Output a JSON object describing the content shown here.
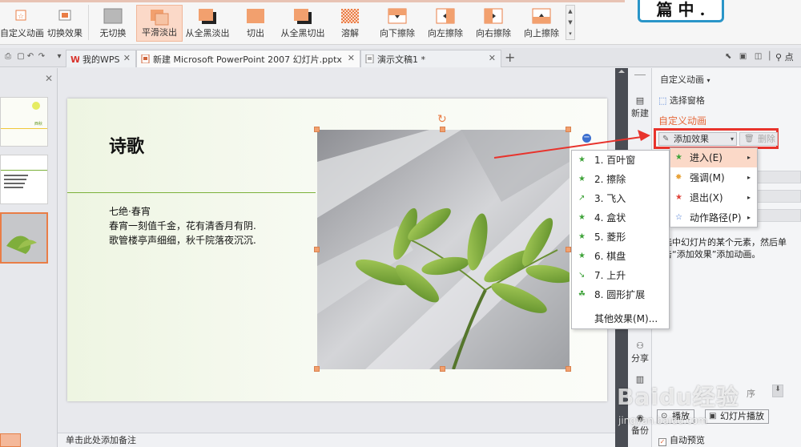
{
  "ribbon": {
    "custom_anim": "自定义动画",
    "switch_effect": "切换效果",
    "transitions": [
      "无切换",
      "平滑淡出",
      "从全黑淡出",
      "切出",
      "从全黑切出",
      "溶解",
      "向下擦除",
      "向左擦除",
      "向右擦除",
      "向上擦除"
    ],
    "active_transition": "平滑淡出"
  },
  "badge": {
    "text": "篇 中 ."
  },
  "tabbar": {
    "wps_tab": "我的WPS",
    "doc_tab": "新建 Microsoft PowerPoint 2007 幻灯片.pptx",
    "demo_tab": "演示文稿1 *",
    "search": "点"
  },
  "slide": {
    "title": "诗歌",
    "poem_title": "七绝·春宵",
    "poem_line1": "春宵一刻值千金，花有清香月有阴.",
    "poem_line2": "歌管楼亭声细细，秋千院落夜沉沉."
  },
  "notes": {
    "placeholder": "单击此处添加备注"
  },
  "vstrip": {
    "new": "新建",
    "share": "分享",
    "backup": "备份"
  },
  "panel": {
    "header": "自定义动画",
    "select_pane": "选择窗格",
    "title": "自定义动画",
    "add_effect": "添加效果",
    "delete": "删除",
    "hint": "选中幻灯片的某个元素，然后单击“添加效果”添加动画。",
    "reorder": "序",
    "play": "播放",
    "slideshow": "幻灯片播放",
    "auto_preview": "自动预览"
  },
  "effect_menu": {
    "items": [
      "1. 百叶窗",
      "2. 擦除",
      "3. 飞入",
      "4. 盒状",
      "5. 菱形",
      "6. 棋盘",
      "7. 上升",
      "8. 圆形扩展"
    ],
    "more": "其他效果(M)..."
  },
  "category_menu": {
    "items": [
      {
        "label": "进入(E)",
        "color": "#3fa33a"
      },
      {
        "label": "强调(M)",
        "color": "#e8a33a"
      },
      {
        "label": "退出(X)",
        "color": "#e0443b"
      },
      {
        "label": "动作路径(P)",
        "color": "#3a6fd0"
      }
    ]
  },
  "watermark": {
    "main": "Baidu经验",
    "sub": "jingyan.baidu.com"
  },
  "colors": {
    "accent": "#e5683a",
    "highlight": "#e8332c",
    "ribbon_active": "#fbd9c8"
  }
}
